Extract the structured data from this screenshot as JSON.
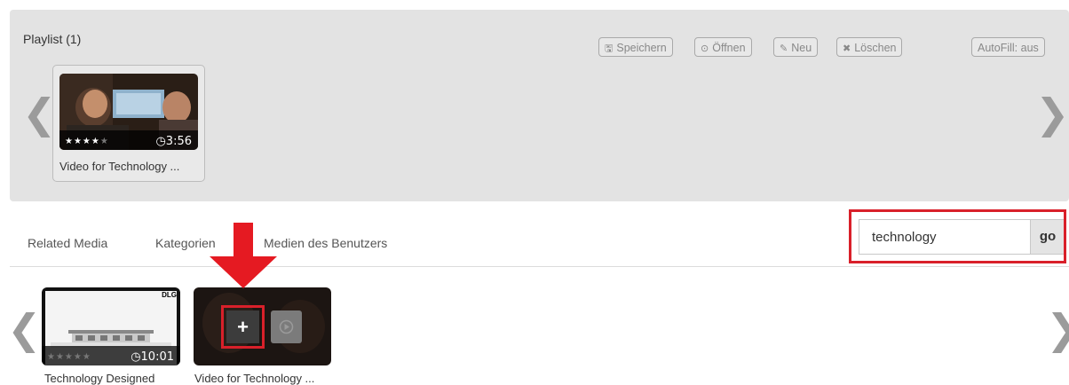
{
  "playlist": {
    "title": "Playlist (1)",
    "buttons": {
      "save": {
        "icon": "floppy-icon",
        "glyph": "🖫",
        "label": "Speichern"
      },
      "open": {
        "icon": "play-circle-icon",
        "glyph": "⊙",
        "label": "Öffnen"
      },
      "new": {
        "icon": "edit-icon",
        "glyph": "✎",
        "label": "Neu"
      },
      "delete": {
        "icon": "x-icon",
        "glyph": "✖",
        "label": "Löschen"
      },
      "autofill": {
        "label": "AutoFill: aus"
      }
    },
    "arrows": {
      "prev": "❮",
      "next": "❯"
    },
    "items": [
      {
        "title": "Video for Technology ...",
        "duration": "3:56",
        "clock": "◷",
        "rating": 4,
        "stars_filled": "★★★★",
        "stars_empty": "★"
      }
    ]
  },
  "tabs": {
    "related": "Related Media",
    "categories": "Kategorien",
    "user_media": "Medien des Benutzers"
  },
  "search": {
    "value": "technology",
    "button": "go"
  },
  "media": {
    "arrows": {
      "prev": "❮",
      "next": "❯"
    },
    "items": [
      {
        "title": "Technology Designed",
        "duration": "10:01",
        "clock": "◷",
        "logo": "DLG",
        "stars_empty": "★★★★★"
      },
      {
        "title": "Video for Technology ...",
        "add_glyph": "+"
      }
    ]
  },
  "colors": {
    "highlight": "#d9202a",
    "panel": "#e3e3e3",
    "arrow": "#9b9b9b"
  }
}
